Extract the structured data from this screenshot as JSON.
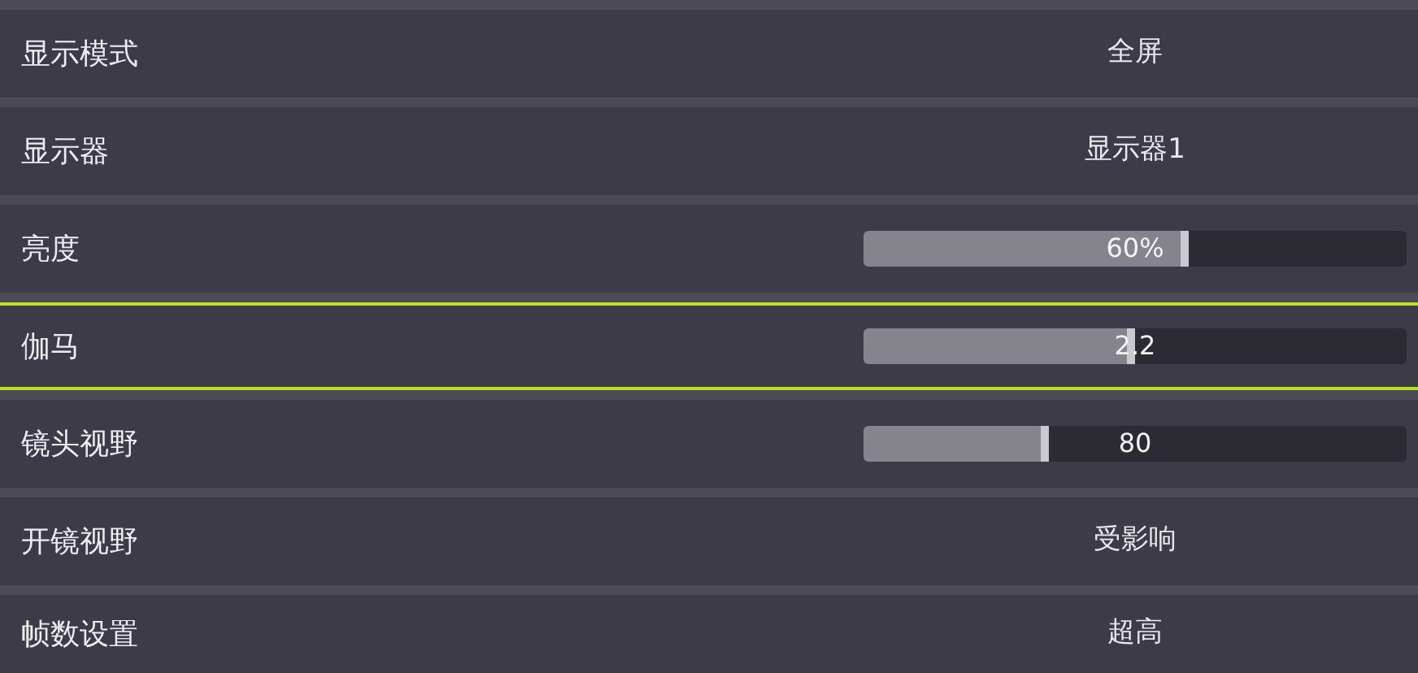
{
  "settings": [
    {
      "kind": "value",
      "label": "显示模式",
      "value": "全屏",
      "selected": false
    },
    {
      "kind": "value",
      "label": "显示器",
      "value": "显示器1",
      "selected": false
    },
    {
      "kind": "slider",
      "label": "亮度",
      "reading": "60%",
      "level": 0.6,
      "selected": false
    },
    {
      "kind": "slider",
      "label": "伽马",
      "reading": "2.2",
      "level": 0.5,
      "selected": true
    },
    {
      "kind": "slider",
      "label": "镜头视野",
      "reading": "80",
      "level": 0.34,
      "selected": false
    },
    {
      "kind": "value",
      "label": "开镜视野",
      "value": "受影响",
      "selected": false
    },
    {
      "kind": "value",
      "label": "帧数设置",
      "value": "超高",
      "selected": false
    }
  ]
}
